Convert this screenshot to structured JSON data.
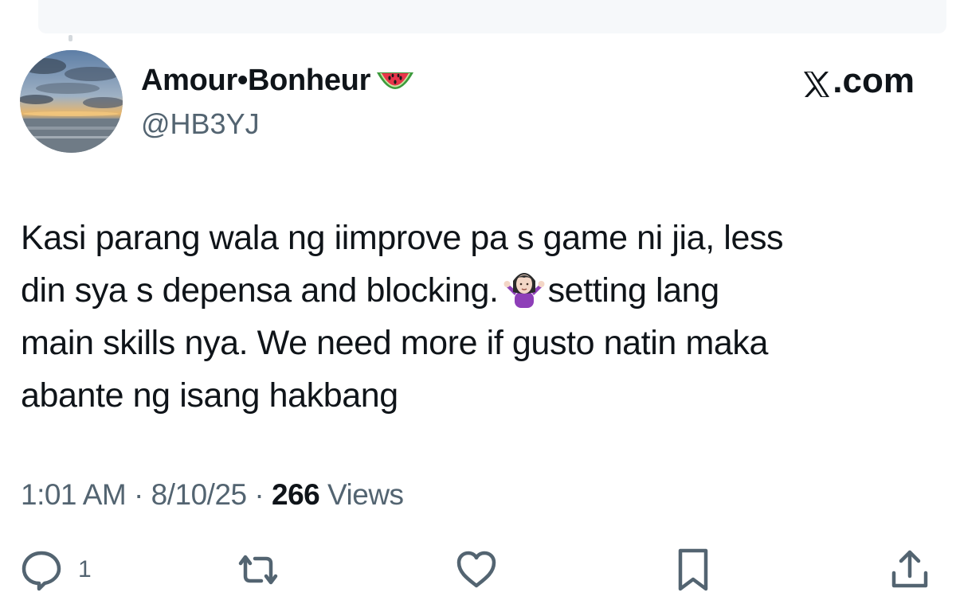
{
  "post": {
    "display_name": "Amour•Bonheur",
    "name_emoji": "watermelon-emoji",
    "handle": "@HB3YJ",
    "brand": ".com",
    "brand_icon": "x-logo-icon",
    "text_lines": [
      "Kasi parang wala ng iimprove pa s game ni jia, less",
      "din sya s depensa and blocking.",
      "setting lang",
      "main skills nya. We need more if gusto natin maka",
      "abante ng isang hakbang"
    ],
    "inline_emoji": "person-shrugging-emoji",
    "time": "1:01 AM",
    "separator": "·",
    "date": "8/10/25",
    "views_count": "266",
    "views_label": "Views"
  },
  "actions": {
    "reply_count": "1",
    "icons": [
      "reply-icon",
      "repost-icon",
      "like-icon",
      "bookmark-icon",
      "share-icon"
    ]
  },
  "colors": {
    "text": "#0f1419",
    "secondary": "#536471",
    "background": "#ffffff"
  }
}
